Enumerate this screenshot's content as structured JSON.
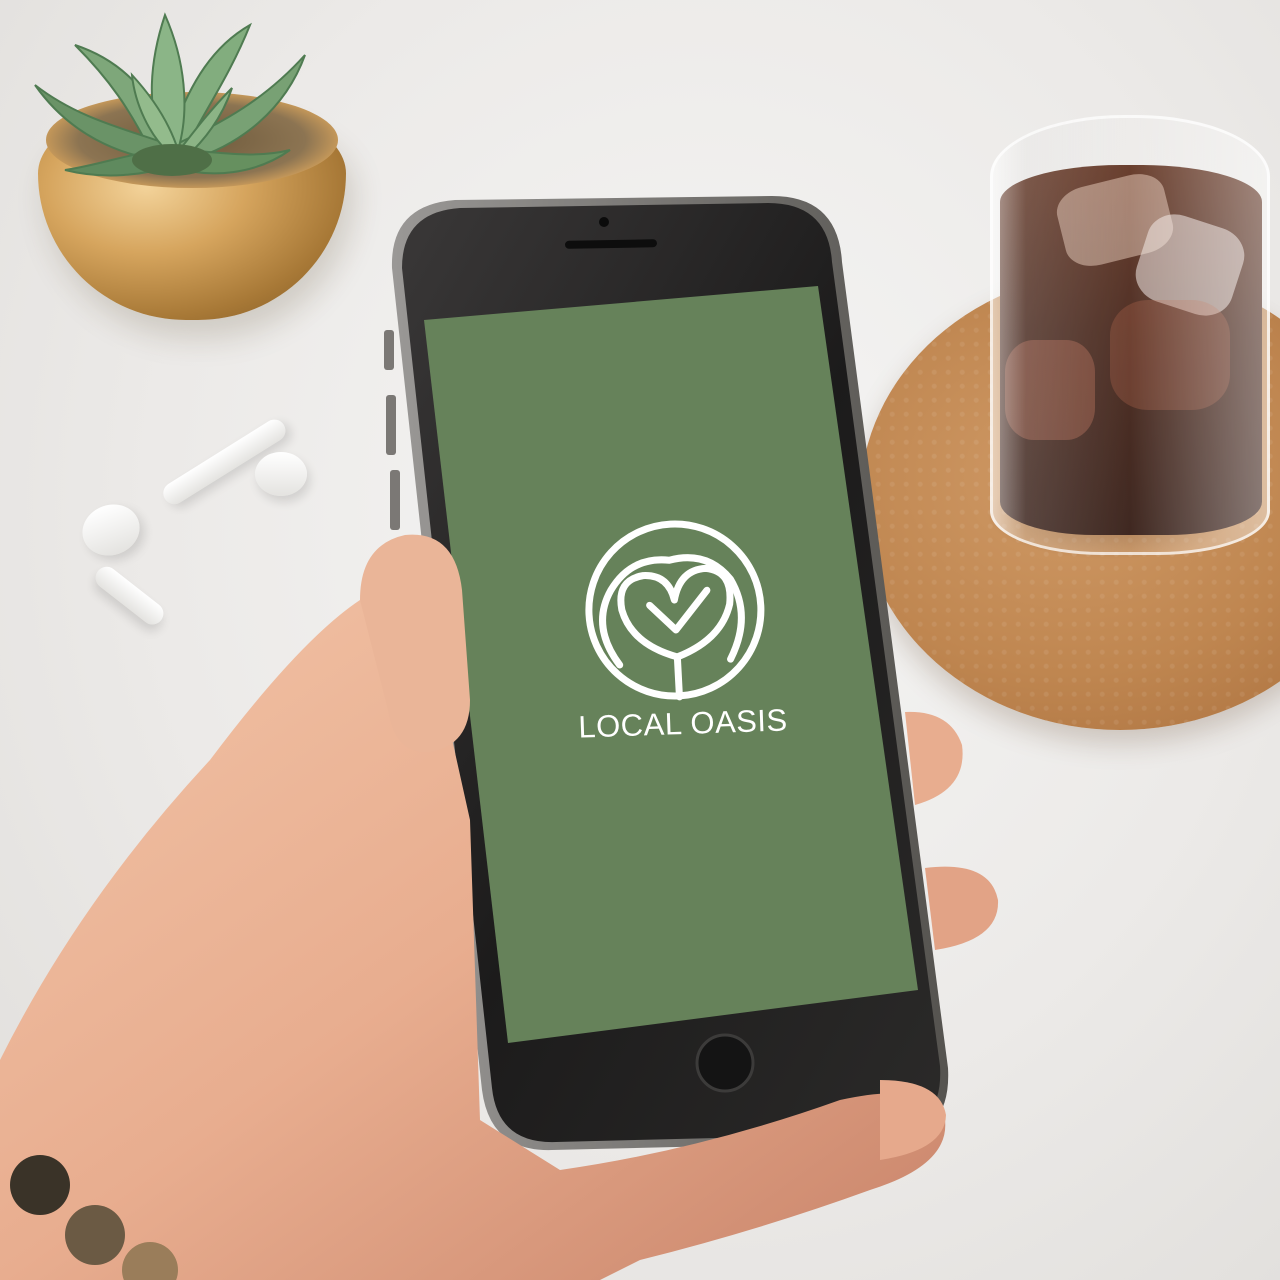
{
  "screen": {
    "background_color": "#66825a",
    "logo": {
      "icon": "heart-tree-circle-logo-icon",
      "color": "#ffffff"
    },
    "brand_name": "LOCAL OASIS"
  },
  "device": {
    "type": "smartphone",
    "home_button": "home-button"
  },
  "scene": {
    "objects": [
      "succulent-pot",
      "wireless-earbuds",
      "cork-coaster",
      "iced-coffee-glass",
      "hand"
    ]
  }
}
